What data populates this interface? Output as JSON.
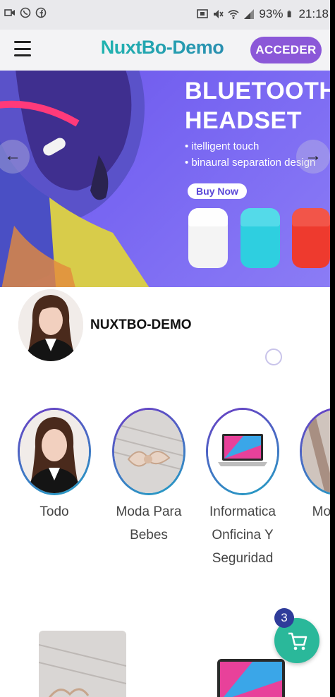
{
  "status_bar": {
    "left_icons": [
      "video-icon",
      "whatsapp-icon",
      "facebook-icon"
    ],
    "right_icons": [
      "cast-icon",
      "mute-icon",
      "wifi-icon",
      "signal-icon"
    ],
    "battery": "93%",
    "time": "21:18"
  },
  "header": {
    "menu_icon": "hamburger-icon",
    "brand": "NuxtBo-Demo",
    "login_label": "ACCEDER",
    "brand_color": "#1fb6b0",
    "accent": "#8b58d8"
  },
  "banner": {
    "title_line1": "BLUETOOTH",
    "title_line2": "HEADSET",
    "feature1": "• itelligent touch",
    "feature2": "• binaural separation design",
    "cta": "Buy Now",
    "prev_icon": "arrow-left-icon",
    "next_icon": "arrow-right-icon",
    "case_colors": [
      "#f4f4f4",
      "#2ecfe0",
      "#ee3a2e"
    ]
  },
  "shop": {
    "name": "NUXTBO-DEMO"
  },
  "categories": [
    {
      "label": "Todo"
    },
    {
      "label": "Moda Para Bebes"
    },
    {
      "label": "Informatica Onficina Y Seguridad"
    },
    {
      "label": "Moda M"
    }
  ],
  "cart": {
    "count": "3",
    "icon": "cart-icon",
    "color": "#2ab89a"
  }
}
